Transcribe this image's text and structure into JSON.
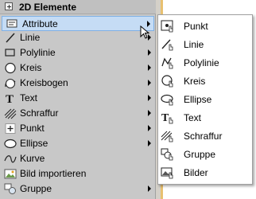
{
  "left_menu": {
    "title": "2D Elemente",
    "items": [
      {
        "label": "Attribute",
        "icon": "attribute-icon",
        "has_submenu": true,
        "selected": true
      },
      {
        "label": "Linie",
        "icon": "line-icon",
        "has_submenu": true
      },
      {
        "label": "Polylinie",
        "icon": "polyline-icon",
        "has_submenu": true
      },
      {
        "label": "Kreis",
        "icon": "circle-icon",
        "has_submenu": true
      },
      {
        "label": "Kreisbogen",
        "icon": "arc-icon",
        "has_submenu": true
      },
      {
        "label": "Text",
        "icon": "text-icon",
        "has_submenu": true
      },
      {
        "label": "Schraffur",
        "icon": "hatch-icon",
        "has_submenu": true
      },
      {
        "label": "Punkt",
        "icon": "point-icon",
        "has_submenu": true
      },
      {
        "label": "Ellipse",
        "icon": "ellipse-icon",
        "has_submenu": true
      },
      {
        "label": "Kurve",
        "icon": "curve-icon",
        "has_submenu": false
      },
      {
        "label": "Bild importieren",
        "icon": "image-import-icon",
        "has_submenu": false
      },
      {
        "label": "Gruppe",
        "icon": "group-icon",
        "has_submenu": true
      }
    ]
  },
  "submenu": {
    "items": [
      {
        "label": "Punkt",
        "icon": "point-attribute-icon"
      },
      {
        "label": "Linie",
        "icon": "line-attribute-icon"
      },
      {
        "label": "Polylinie",
        "icon": "polyline-attribute-icon"
      },
      {
        "label": "Kreis",
        "icon": "circle-attribute-icon"
      },
      {
        "label": "Ellipse",
        "icon": "ellipse-attribute-icon"
      },
      {
        "label": "Text",
        "icon": "text-attribute-icon"
      },
      {
        "label": "Schraffur",
        "icon": "hatch-attribute-icon"
      },
      {
        "label": "Gruppe",
        "icon": "group-attribute-icon"
      },
      {
        "label": "Bilder",
        "icon": "image-attribute-icon"
      }
    ]
  },
  "colors": {
    "menu_bg": "#c8c8c8",
    "selected_bg": "#c5dcf5",
    "selected_border": "#7fb0e4",
    "submenu_bg": "#ffffff"
  }
}
